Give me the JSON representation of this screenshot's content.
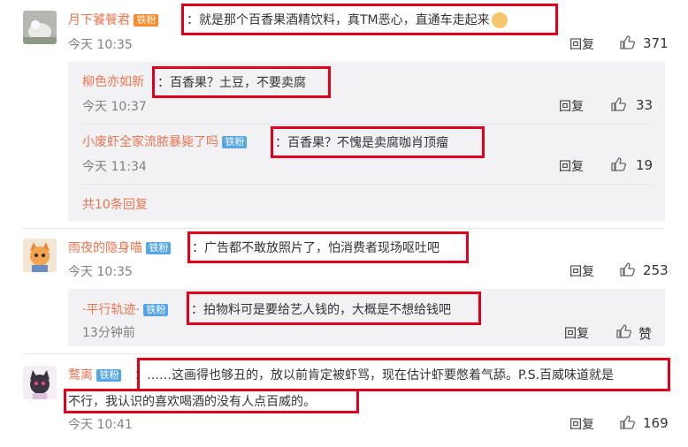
{
  "comments": [
    {
      "name": "月下饕餮君",
      "badge": "铁粉",
      "text": "：就是那个百香果酒精饮料，真TM恶心，直通车走起来",
      "time": "今天 10:35",
      "reply_label": "回复",
      "likes": "371",
      "replies": [
        {
          "name": "柳色亦如新",
          "text": "：百香果？土豆，不要卖腐",
          "time": "今天 10:37",
          "reply_label": "回复",
          "likes": "33"
        },
        {
          "name": "小废虾全家流脓暴毙了吗",
          "badge": "铁粉",
          "text": "：百香果？不愧是卖腐咖肖顶瘤",
          "time": "今天 11:34",
          "reply_label": "回复",
          "likes": "19"
        }
      ],
      "more_label": "共10条回复"
    },
    {
      "name": "雨夜的隐身喵",
      "badge": "铁粉",
      "text": "：广告都不敢放照片了，怕消费者现场呕吐吧",
      "time": "今天 10:35",
      "reply_label": "回复",
      "likes": "253",
      "replies": [
        {
          "name": "·平行轨迹·",
          "badge": "铁粉",
          "text": "：拍物料可是要给艺人钱的，大概是不想给钱吧",
          "time": "13分钟前",
          "reply_label": "回复",
          "likes": "赞"
        }
      ]
    },
    {
      "name": "鹜离",
      "badge": "铁粉",
      "text_line1": "：……这画得也够丑的，放以前肯定被虾骂，现在估计虾要憋着气舔。P.S.百威味道就是",
      "text_line2": "不行，我认识的喜欢喝酒的没有人点百威的。",
      "time": "今天 10:41",
      "reply_label": "回复",
      "likes": "169"
    }
  ],
  "colors": {
    "name": "#eb7350",
    "badge": "#56a6e6",
    "highlight": "#e0001b",
    "reply_bg": "#f2f2f5"
  }
}
